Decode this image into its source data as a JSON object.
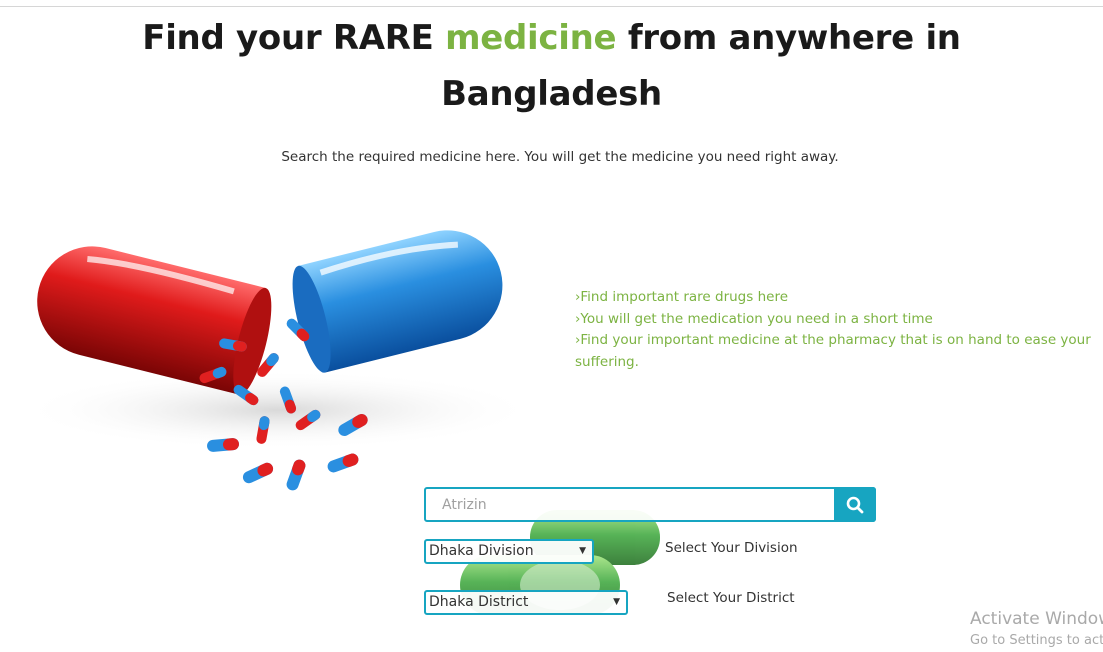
{
  "hero": {
    "title_part1": "Find your RARE ",
    "title_accent": "medicine",
    "title_part2": " from anywhere in",
    "title_line2": "Bangladesh",
    "accent_color": "#7cb342"
  },
  "subtitle": "Search the required medicine here. You will get the medicine you need right away.",
  "features": [
    "›Find important rare drugs here",
    "›You will get the medication you need in a short time",
    "›Find your important medicine at the pharmacy that is on hand to ease your suffering."
  ],
  "search": {
    "value": "",
    "placeholder": "Atrizin",
    "icon": "search-icon",
    "accent_color": "#17a5c1"
  },
  "division": {
    "selected": "Dhaka Division",
    "label": "Select Your Division"
  },
  "district": {
    "selected": "Dhaka District",
    "label": "Select Your District"
  },
  "watermark": {
    "line1": "Activate Windows",
    "line2": "Go to Settings to activate Windows."
  }
}
